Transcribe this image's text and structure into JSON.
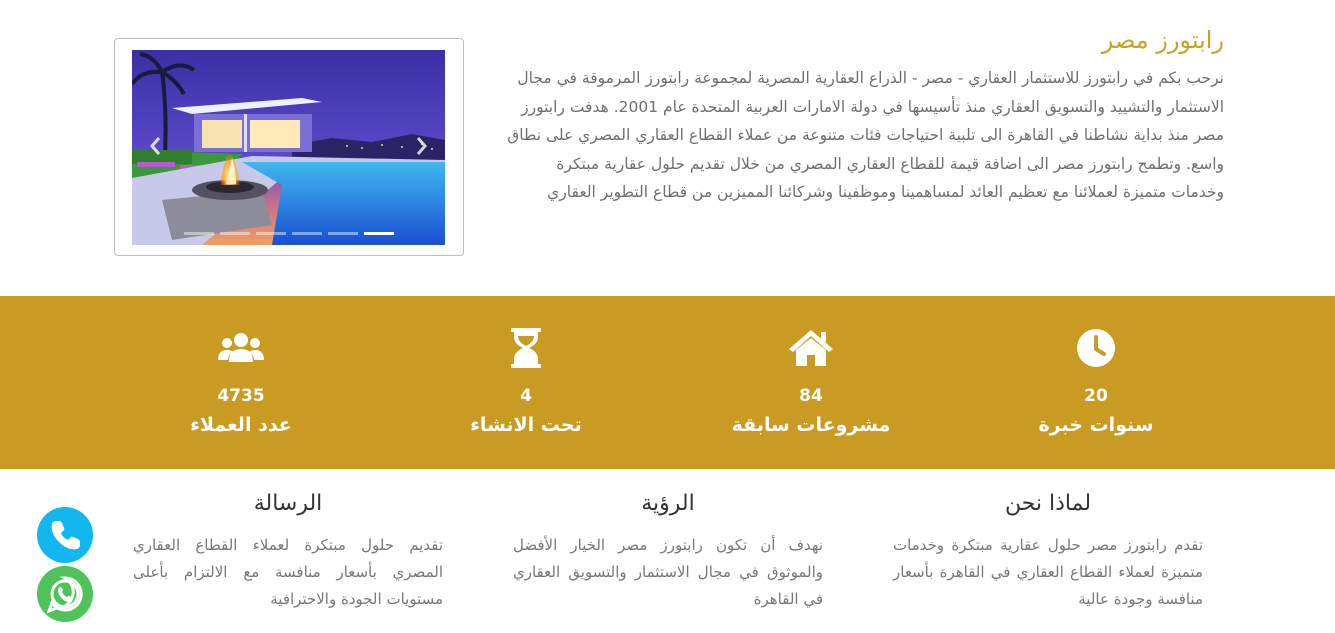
{
  "about": {
    "title": "رابتورز مصر",
    "body": "نرحب بكم في رابتورز للاستثمار العقاري - مصر - الذراع العقارية المصرية لمجموعة رابتورز المرموقة في مجال الاستثمار والتشييد والتسويق العقاري منذ تأسيسها في دولة الامارات العربية المتحدة عام 2001. هدفت رابتورز مصر منذ بداية نشاطنا في القاهرة الى تلبية احتياجات فئات متنوعة من عملاء القطاع العقاري المصري على نطاق واسع. وتطمح رابتورز مصر الى اضافة قيمة للقطاع العقاري المصري من خلال تقديم حلول عقارية مبتكرة وخدمات متميزة لعملائنا مع تعظيم العائد لمساهمينا وموظفينا وشركائنا المميزين من قطاع التطوير العقاري"
  },
  "slider": {
    "prev_icon": "chevron-left-icon",
    "next_icon": "chevron-right-icon",
    "slide_count": 6,
    "active_index": 5
  },
  "stats": [
    {
      "icon": "users-icon",
      "value": "4735",
      "label": "عدد العملاء"
    },
    {
      "icon": "hourglass-icon",
      "value": "4",
      "label": "تحت الانشاء"
    },
    {
      "icon": "home-icon",
      "value": "84",
      "label": "مشروعات سابقة"
    },
    {
      "icon": "clock-icon",
      "value": "20",
      "label": "سنوات خبرة"
    }
  ],
  "columns": {
    "why_us": {
      "title": "لماذا نحن",
      "text": "تقدم رابتورز مصر حلول عقارية مبتكرة وخدمات متميزة لعملاء القطاع العقاري في القاهرة بأسعار منافسة وجودة عالية"
    },
    "vision": {
      "title": "الرؤية",
      "text": "نهدف أن تكون رابتورز مصر الخيار الأفضل والموثوق في مجال الاستثمار والتسويق العقاري في القاهرة"
    },
    "mission": {
      "title": "الرسالة",
      "text": "تقديم حلول مبتكرة لعملاء القطاع العقاري المصري بأسعار منافسة مع الالتزام بأعلى مستويات الجودة والاحترافية"
    }
  },
  "floating": {
    "phone_icon": "phone-icon",
    "whatsapp_icon": "whatsapp-icon"
  },
  "colors": {
    "gold": "#c99b23",
    "title_gold": "#c9a227",
    "phone": "#13b7f0",
    "whatsapp": "#4fc259"
  }
}
